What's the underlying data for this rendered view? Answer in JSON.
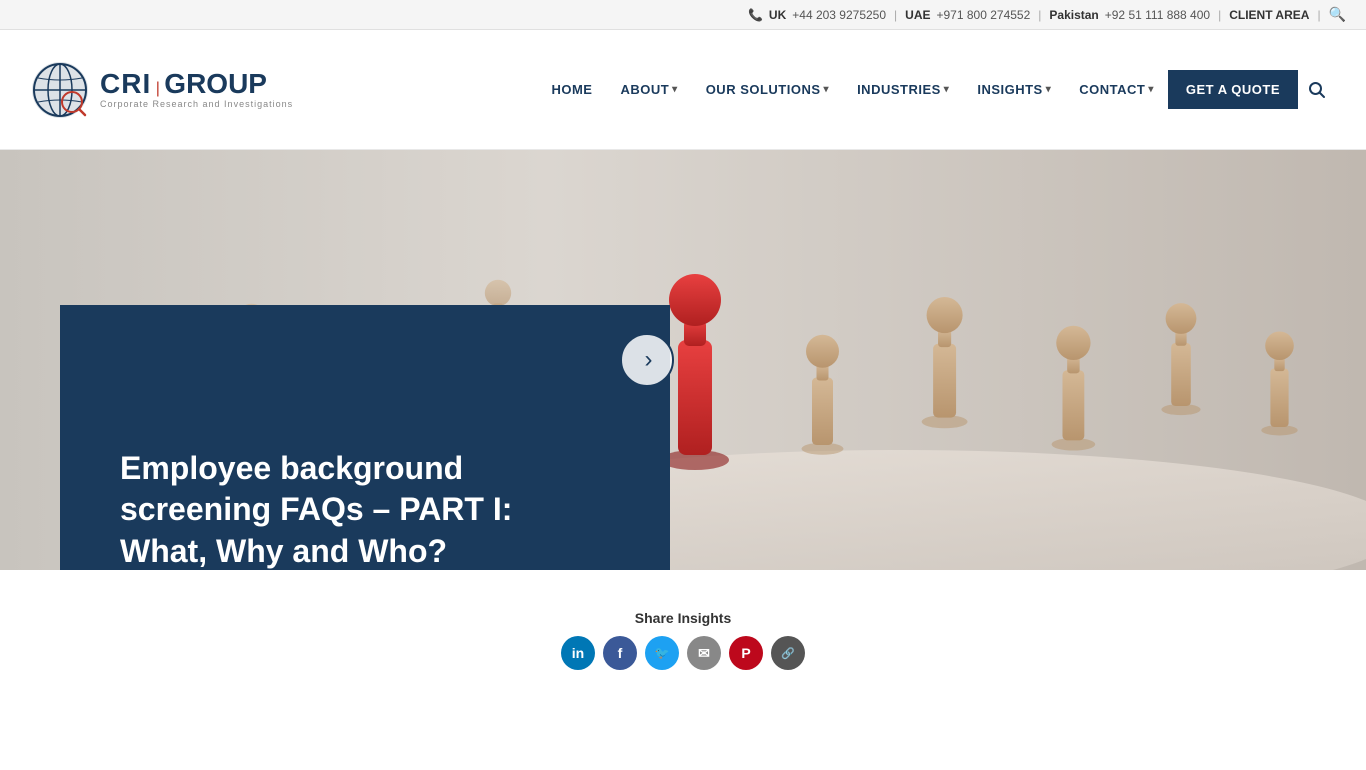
{
  "topbar": {
    "uk_label": "UK",
    "uk_phone": "+44 203 9275250",
    "uae_label": "UAE",
    "uae_phone": "+971 800 274552",
    "pakistan_label": "Pakistan",
    "pakistan_phone": "+92 51 111 888 400",
    "client_area": "CLIENT AREA"
  },
  "logo": {
    "cri": "CRI",
    "divider": "|",
    "group": "GROUP",
    "subtitle": "Corporate Research and Investigations"
  },
  "nav": {
    "items": [
      {
        "label": "HOME",
        "has_arrow": false
      },
      {
        "label": "ABOUT",
        "has_arrow": true
      },
      {
        "label": "OUR SOLUTIONS",
        "has_arrow": true
      },
      {
        "label": "INDUSTRIES",
        "has_arrow": true
      },
      {
        "label": "INSIGHTS",
        "has_arrow": true
      },
      {
        "label": "CONTACT",
        "has_arrow": true
      }
    ],
    "cta": "GET A QUOTE"
  },
  "hero": {
    "title": "Employee background screening FAQs – PART I: What, Why and Who?",
    "arrow_label": "›"
  },
  "share": {
    "title": "Share Insights",
    "icons": [
      {
        "name": "LinkedIn",
        "abbr": "in",
        "class": "si-linkedin"
      },
      {
        "name": "Facebook",
        "abbr": "f",
        "class": "si-facebook"
      },
      {
        "name": "Twitter",
        "abbr": "t",
        "class": "si-twitter"
      },
      {
        "name": "Email",
        "abbr": "✉",
        "class": "si-email"
      },
      {
        "name": "Pinterest",
        "abbr": "P",
        "class": "si-pinterest"
      },
      {
        "name": "Link",
        "abbr": "⚓",
        "class": "si-link"
      }
    ]
  }
}
